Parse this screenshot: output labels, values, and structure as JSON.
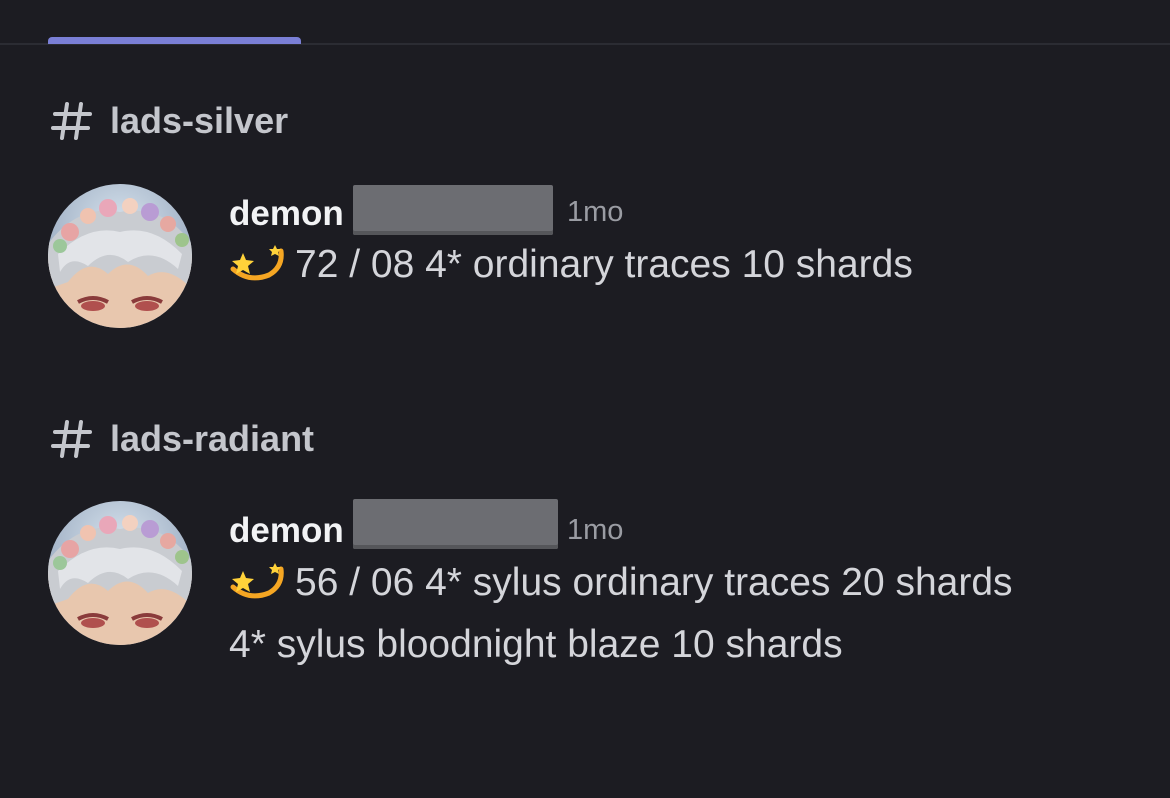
{
  "channels": [
    {
      "name": "lads-silver",
      "icon": "hash-icon",
      "message": {
        "username": "demon",
        "timestamp": "1mo",
        "emoji": "dizzy-shooting-star-emoji",
        "text": "72 / 08 4* ordinary traces 10 shards"
      }
    },
    {
      "name": "lads-radiant",
      "icon": "hash-icon",
      "message": {
        "username": "demon",
        "timestamp": "1mo",
        "emoji": "dizzy-shooting-star-emoji",
        "text": "56 / 06 4* sylus ordinary traces 20 shards 4* sylus bloodnight blaze 10 shards"
      }
    }
  ],
  "colors": {
    "background": "#1c1c22",
    "tab_accent": "#7a7fd6",
    "username": "#f2f3f5",
    "message_text": "#d4d5da",
    "timestamp": "#9a9ca3"
  }
}
